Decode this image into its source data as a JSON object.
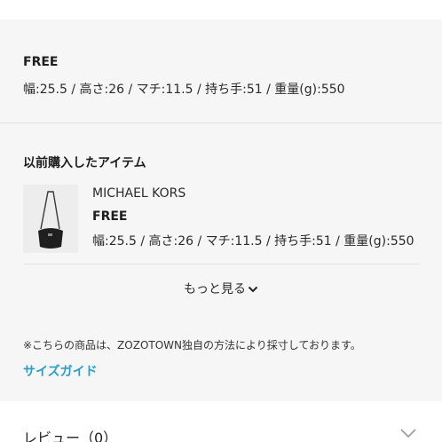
{
  "size_section": {
    "size_name": "FREE",
    "size_detail": "幅:25.5 / 高さ:26 / マチ:11.5 / 持ち手:51 / 重量(g):550"
  },
  "previous_purchase": {
    "title": "以前購入したアイテム",
    "item": {
      "brand": "MICHAEL KORS",
      "size": "FREE",
      "detail": "幅:25.5 / 高さ:26 / マチ:11.5 / 持ち手:51 / 重量(g):550"
    },
    "more_label": "もっと見る"
  },
  "note": "※こちらの商品は、ZOZOTOWN独自の方法により採寸しております。",
  "size_guide_label": "サイズガイド",
  "review": {
    "label": "レビュー（0）"
  },
  "colors": {
    "link": "#2a9ec4",
    "panel_bg": "#f6f6f6"
  },
  "icons": [
    "chevron-down-icon",
    "chevron-down-icon"
  ]
}
